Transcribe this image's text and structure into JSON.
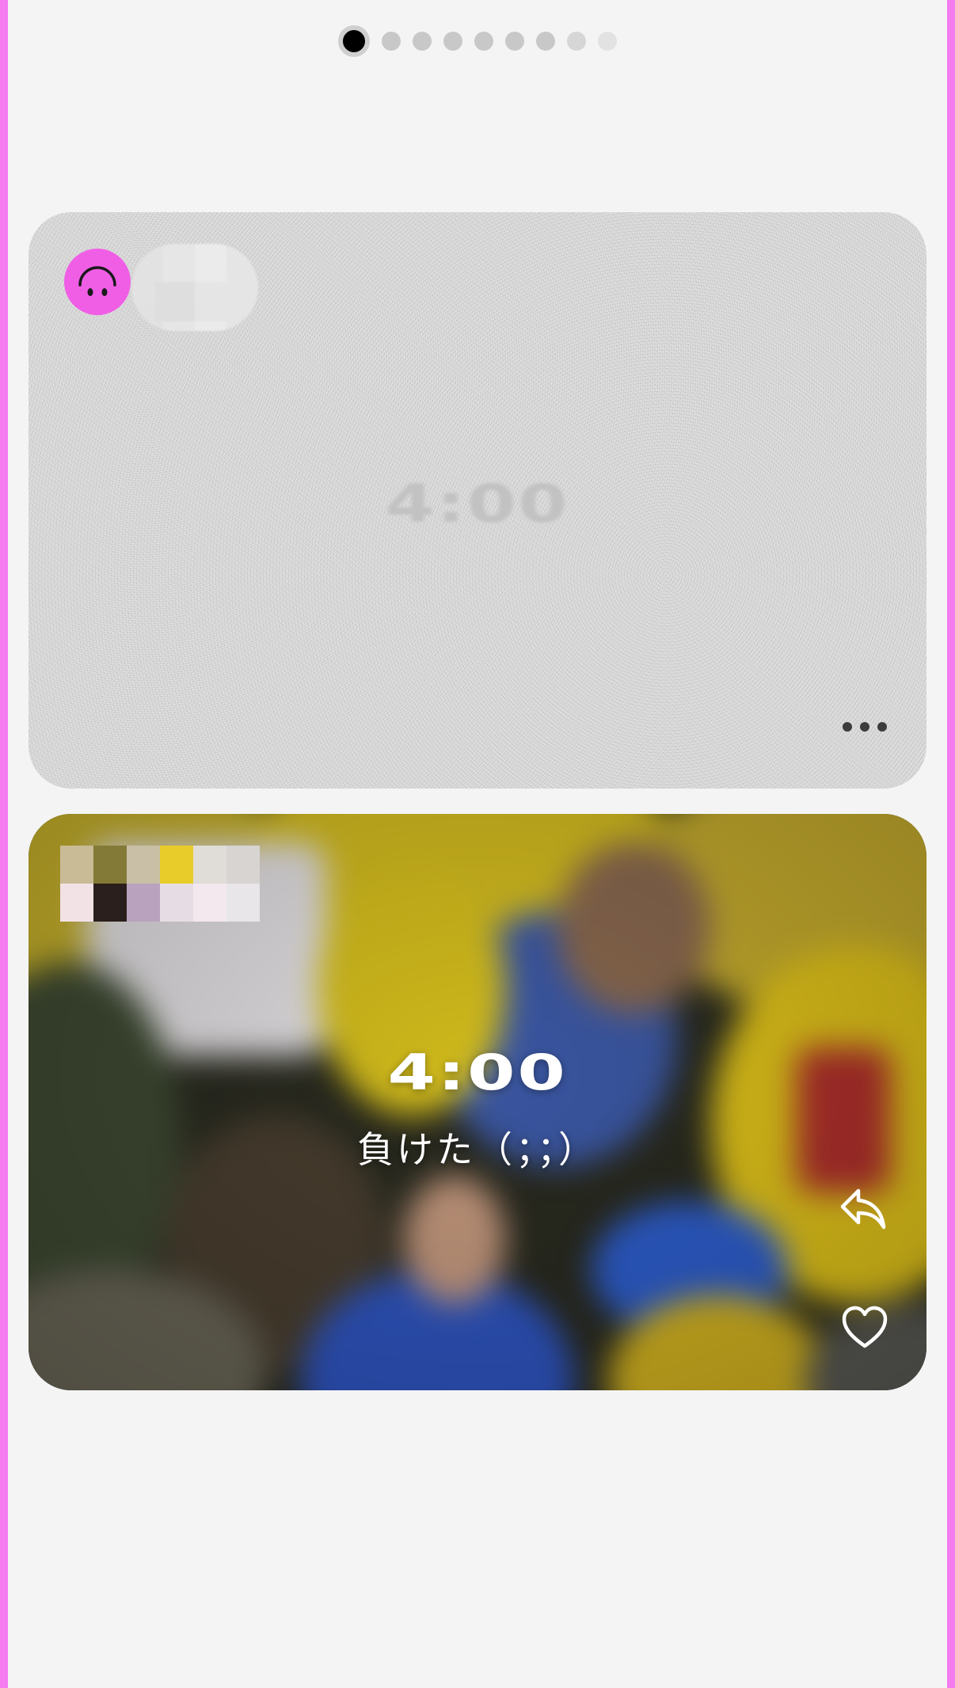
{
  "pager": {
    "dot_count": 9,
    "active_index": 0
  },
  "posts": [
    {
      "time": "4:00",
      "avatar_icon": "upside-down-smiley-icon",
      "more_icon": "more-dots-icon",
      "state": "hidden-blurred"
    },
    {
      "time": "4:00",
      "caption": "負けた（；；）",
      "reply_icon": "reply-arrow-icon",
      "like_icon": "heart-icon"
    }
  ],
  "colors": {
    "background": "#f4f4f4",
    "frame_accent": "#f47bf0",
    "avatar": "#f05ee6",
    "text_on_photo": "#ffffff"
  }
}
